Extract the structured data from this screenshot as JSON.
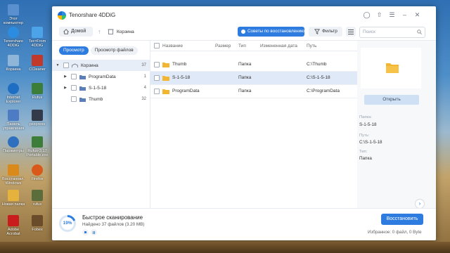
{
  "desktop": {
    "icons": [
      {
        "label": "Этот компьютер",
        "color": "#5a8fd0"
      },
      {
        "label": "Tenorshare 4DDiG",
        "color": "#2c8de0"
      },
      {
        "label": "ТестFrom 4DDiG",
        "color": "#4da3e8"
      },
      {
        "label": "Корзина",
        "color": "#8fb5d8"
      },
      {
        "label": "CCleaner",
        "color": "#c0392b"
      },
      {
        "label": "Internet Explorer",
        "color": "#1e6fc4"
      },
      {
        "label": "Rufus",
        "color": "#3c7d3a"
      },
      {
        "label": "Панель управления",
        "color": "#4d7cc4"
      },
      {
        "label": "psxpress",
        "color": "#333a4a"
      },
      {
        "label": "Параметры",
        "color": "#2f6fbf"
      },
      {
        "label": "Rufus-3.17 Portable.exe",
        "color": "#3c7d3a"
      },
      {
        "label": "Восстановл. Windows",
        "color": "#d98a1a"
      },
      {
        "label": "Firefox",
        "color": "#d9591a"
      },
      {
        "label": "Новая папка",
        "color": "#e5b23d"
      },
      {
        "label": "rufus",
        "color": "#5a6d3a"
      },
      {
        "label": "Adobe Acrobat",
        "color": "#c91d1d"
      },
      {
        "label": "Fobex",
        "color": "#6b4c2a"
      }
    ]
  },
  "app": {
    "title": "Tenorshare 4DDiG"
  },
  "titlebar": {
    "headset_icon": "headset-icon",
    "share_icon": "share-icon",
    "menu_icon": "menu-icon"
  },
  "toolbar": {
    "home_label": "Домой",
    "breadcrumb": "Корзина",
    "tips_label": "Советы по восстановлению",
    "filter_label": "Фильтр",
    "search_placeholder": "Поиск"
  },
  "left": {
    "tabs": [
      "Просмотр",
      "Просмотр файлов"
    ],
    "tree": [
      {
        "label": "Корзина",
        "count": "37"
      },
      {
        "label": "ProgramData",
        "count": "1"
      },
      {
        "label": "S-1-5-18",
        "count": "4"
      },
      {
        "label": "Thumb",
        "count": "32"
      }
    ]
  },
  "table": {
    "headers": {
      "name": "Название",
      "size": "Размер",
      "type": "Тип",
      "modified": "Измененная дата",
      "path": "Путь"
    },
    "rows": [
      {
        "name": "Thumb",
        "size": "",
        "type": "Папка",
        "modified": "",
        "path": "C:\\Thumb"
      },
      {
        "name": "S-1-5-18",
        "size": "",
        "type": "Папка",
        "modified": "",
        "path": "C:\\S-1-5-18"
      },
      {
        "name": "ProgramData",
        "size": "",
        "type": "Папка",
        "modified": "",
        "path": "C:\\ProgramData"
      }
    ]
  },
  "preview": {
    "open_label": "Открыть",
    "folder_label": "Папка:",
    "folder_value": "S-1-5-18",
    "path_label": "Путь:",
    "path_value": "C:\\S-1-5-18",
    "type_label": "Тип:",
    "type_value": "Папка"
  },
  "bottom": {
    "progress": "19%",
    "progress_fraction": 0.19,
    "scan_title": "Быстрое сканирование",
    "scan_sub": "Найдено 37 файлов (3.20 MB)",
    "restore_label": "Восстановить",
    "selected_info": "Избранное: 0 файл, 0 Byte"
  },
  "colors": {
    "accent": "#2f7ce0",
    "folder": "#f2b632"
  }
}
